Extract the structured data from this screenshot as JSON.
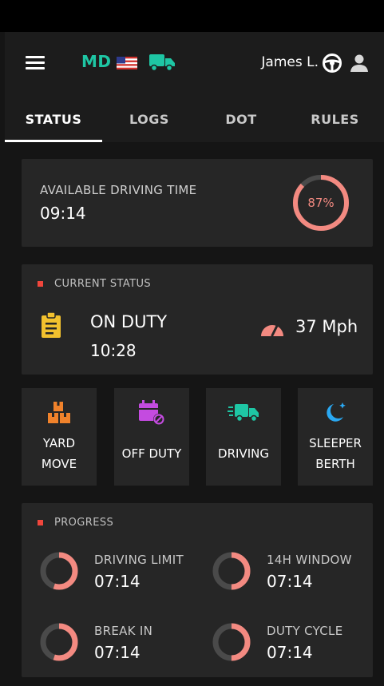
{
  "header": {
    "state_code": "MD",
    "driver_name": "James L."
  },
  "tabs": [
    {
      "label": "STATUS"
    },
    {
      "label": "LOGS"
    },
    {
      "label": "DOT"
    },
    {
      "label": "RULES"
    }
  ],
  "available": {
    "label": "AVAILABLE DRIVING TIME",
    "value": "09:14",
    "percent_text": "87%",
    "percent": 87
  },
  "current_status": {
    "heading": "CURRENT STATUS",
    "name": "ON DUTY",
    "time": "10:28",
    "speed": "37 Mph"
  },
  "duty_buttons": [
    {
      "line1": "YARD",
      "line2": "MOVE",
      "icon": "boxes-icon"
    },
    {
      "line1": "OFF DUTY",
      "line2": "",
      "icon": "calendar-off-icon"
    },
    {
      "line1": "DRIVING",
      "line2": "",
      "icon": "truck-moving-icon"
    },
    {
      "line1": "SLEEPER",
      "line2": "BERTH",
      "icon": "moon-icon"
    }
  ],
  "progress": {
    "heading": "PROGRESS",
    "items": [
      {
        "label": "DRIVING LIMIT",
        "value": "07:14",
        "fraction": 0.55
      },
      {
        "label": "14H WINDOW",
        "value": "07:14",
        "fraction": 0.5
      },
      {
        "label": "BREAK IN",
        "value": "07:14",
        "fraction": 0.55
      },
      {
        "label": "DUTY CYCLE",
        "value": "07:14",
        "fraction": 0.5
      }
    ]
  },
  "colors": {
    "accent_teal": "#1ec6a4",
    "ring_salmon": "#f38a81",
    "ring_track": "#4a4a4a",
    "bullet_red": "#f0463c",
    "yard_orange": "#f0822b",
    "offduty_purple": "#c44be0",
    "moon_blue": "#2aa8f2",
    "clipboard_yellow": "#f2c12e"
  }
}
